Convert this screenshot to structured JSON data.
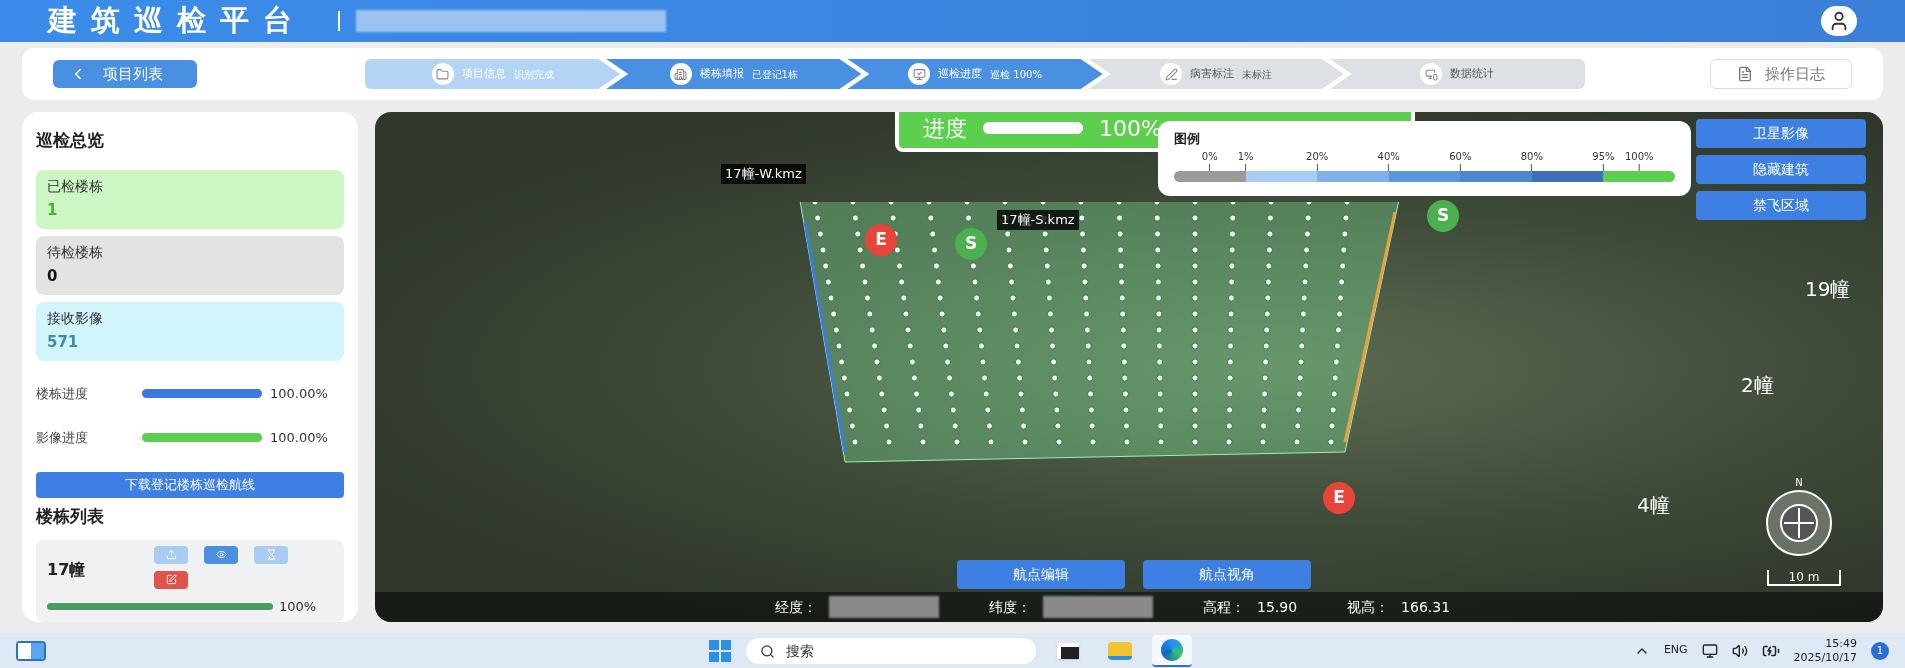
{
  "header": {
    "title": "建筑巡检平台"
  },
  "toolbar": {
    "back_button": "项目列表",
    "log_button": "操作日志",
    "steps": [
      {
        "label": "项目信息",
        "note": "识别完成",
        "kind": "done"
      },
      {
        "label": "楼栋填报",
        "note": "已登记1栋",
        "kind": "active"
      },
      {
        "label": "巡检进度",
        "note": "巡检 100%",
        "kind": "active"
      },
      {
        "label": "病害标注",
        "note": "未标注",
        "kind": "todo"
      },
      {
        "label": "数据统计",
        "kind": "todo"
      }
    ]
  },
  "overview": {
    "title": "巡检总览",
    "stats": [
      {
        "label": "已检楼栋",
        "value": "1",
        "kind": "done"
      },
      {
        "label": "待检楼栋",
        "value": "0",
        "kind": "pending"
      },
      {
        "label": "接收影像",
        "value": "571",
        "kind": "images"
      }
    ],
    "progress": [
      {
        "label": "楼栋进度",
        "level": 1,
        "reading": "100.00%",
        "color": "#3b7be0"
      },
      {
        "label": "影像进度",
        "level": 1,
        "reading": "100.00%",
        "color": "#5ccf4f"
      }
    ],
    "download_button": "下载登记楼栋巡检航线"
  },
  "building_list": {
    "title": "楼栋列表",
    "items": [
      {
        "name": "17幢",
        "level": 1,
        "reading": "100%",
        "actions": [
          {
            "kind": "upload",
            "disabled": true
          },
          {
            "kind": "view",
            "disabled": false
          },
          {
            "kind": "hourglass",
            "disabled": true
          },
          {
            "kind": "edit",
            "disabled": false
          }
        ]
      }
    ]
  },
  "map": {
    "progress_card": {
      "label": "进度",
      "level": 1,
      "reading": "100%"
    },
    "legend": {
      "title": "图例",
      "ticks": [
        "0%",
        "1%",
        "20%",
        "40%",
        "60%",
        "80%",
        "95%",
        "100%"
      ],
      "segments": [
        {
          "color": "#9a9a9a"
        },
        {
          "color": "#a8cdf5"
        },
        {
          "color": "#7fb0ea"
        },
        {
          "color": "#5d95dc"
        },
        {
          "color": "#4f86d0"
        },
        {
          "color": "#3f6fba"
        },
        {
          "color": "#5ccf4f"
        }
      ]
    },
    "layer_buttons": [
      "卫星影像",
      "隐藏建筑",
      "禁飞区域"
    ],
    "route_labels": [
      "17幢-W.kmz",
      "17幢-S.kmz"
    ],
    "markers": [
      {
        "label": "E",
        "kind": "end"
      },
      {
        "label": "S",
        "kind": "start"
      },
      {
        "label": "S",
        "kind": "start"
      },
      {
        "label": "E",
        "kind": "end"
      }
    ],
    "building_labels": [
      "19幢",
      "2幢",
      "4幢"
    ],
    "action_buttons": [
      "航点编辑",
      "航点视角"
    ],
    "compass": "N",
    "scale": "10 m",
    "coords": [
      {
        "label": "经度：",
        "kind": "blurred"
      },
      {
        "label": "纬度：",
        "kind": "blurred"
      },
      {
        "label": "高程：",
        "kind": "text",
        "value": "15.90"
      },
      {
        "label": "视高：",
        "kind": "text",
        "value": "166.31"
      }
    ]
  },
  "taskbar": {
    "placeholder": "搜索",
    "apps": [
      {
        "kind": "taskview",
        "selected": false
      },
      {
        "kind": "files",
        "selected": false
      },
      {
        "kind": "browser",
        "selected": true
      }
    ],
    "language": "ENG",
    "time": "15:49",
    "date": "2025/10/17",
    "notifications": "1"
  }
}
